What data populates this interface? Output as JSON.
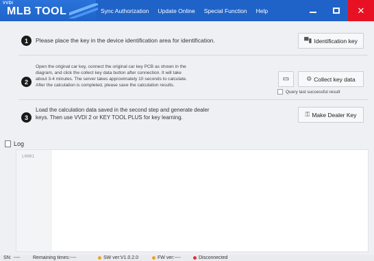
{
  "titlebar": {
    "logo_small": "VVDI",
    "logo_main": "MLB TOOL",
    "menu": [
      "Sync Authorization",
      "Update Online",
      "Special Function",
      "Help"
    ],
    "min_icon": "minimize-icon",
    "max_icon": "maximize-icon",
    "close_symbol": "✕"
  },
  "steps": [
    {
      "number": "1",
      "text": "Please place the key in the device identification area for identification.",
      "button": "Identification key",
      "button_icon": "key-card-icon"
    },
    {
      "number": "2",
      "text_lines": [
        "Open the original car key, connect the original car key PCB as shown in the",
        "diagram, and click the collect key data button after connection. It will take",
        "about 3-4 minutes. The server takes approximately 10 seconds to calculate.",
        "After the calculation is completed, please save the calculation results."
      ],
      "button": "Collect key data",
      "button_icon": "collect-icon",
      "extra_icon": "save-icon",
      "checkbox_label": "Query last successful result"
    },
    {
      "number": "3",
      "text_lines": [
        "Load the calculation data saved in the second step and generate dealer",
        "keys. Then use VVDI 2 or KEY TOOL PLUS for key learning."
      ],
      "button": "Make Dealer Key",
      "button_icon": "make-key-icon"
    }
  ],
  "log": {
    "title": "Log",
    "first_line": "L0001"
  },
  "status": {
    "sn_label": "SN:",
    "sn_value": "----",
    "remaining": "Remaining times:----",
    "sw": "SW ver:V1.0.2.0",
    "fw": "FW ver:----",
    "connection": "Disconnected"
  },
  "colors": {
    "titlebar": "#1f63c8",
    "close": "#e81123",
    "status_ok": "#f0a020",
    "status_error": "#e03030"
  }
}
